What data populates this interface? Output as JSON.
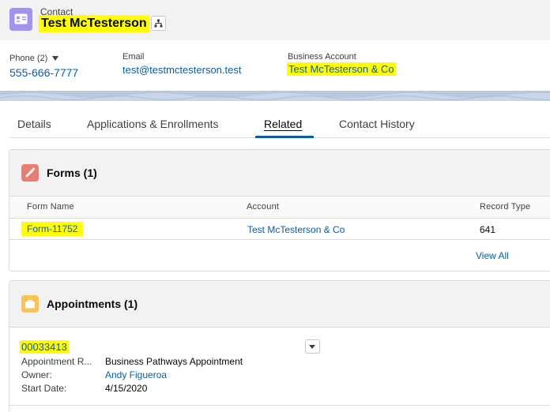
{
  "header": {
    "object_type": "Contact",
    "record_name": "Test McTesterson",
    "object_icon": "contact-card-icon",
    "hierarchy_icon": "hierarchy-icon"
  },
  "highlights": {
    "phone_label": "Phone (2)",
    "phone_value": "555-666-7777",
    "email_label": "Email",
    "email_value": "test@testmctesterson.test",
    "account_label": "Business Account",
    "account_value": "Test McTesterson & Co"
  },
  "tabs": [
    {
      "label": "Details"
    },
    {
      "label": "Applications & Enrollments"
    },
    {
      "label": "Related",
      "active": true
    },
    {
      "label": "Contact History"
    }
  ],
  "forms": {
    "title": "Forms (1)",
    "icon": "edit-pencil-icon",
    "icon_color": "#e67e73",
    "columns": [
      "Form Name",
      "Account",
      "Record Type"
    ],
    "rows": [
      {
        "name": "Form-11752",
        "account": "Test McTesterson & Co",
        "record_type": "641"
      }
    ],
    "view_all": "View All"
  },
  "appointments": {
    "title": "Appointments (1)",
    "icon": "briefcase-icon",
    "icon_color": "#f8c453",
    "record": {
      "id": "00033413",
      "fields": [
        {
          "label": "Appointment R...",
          "value": "Business Pathways Appointment"
        },
        {
          "label": "Owner:",
          "value": "Andy Figueroa"
        },
        {
          "label": "Start Date:",
          "value": "4/15/2020"
        }
      ]
    }
  },
  "colors": {
    "link": "#0b5cab",
    "highlight": "#ffff00",
    "header_bg": "#f3f2f2",
    "contact_icon_bg": "#a094ed"
  }
}
